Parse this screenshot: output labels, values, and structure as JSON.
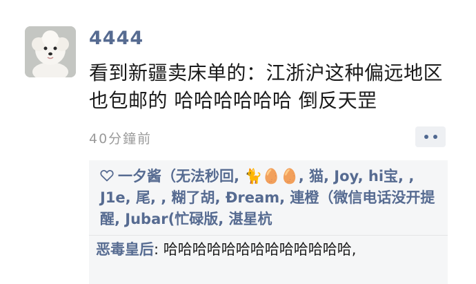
{
  "post": {
    "username": "4444",
    "text": "看到新疆卖床单的：江浙沪这种偏远地区也包邮的 哈哈哈哈哈哈 倒反天罡",
    "timestamp": "40分鐘前",
    "avatar_icon": "bichon-dog-avatar",
    "more_icon": "more-dots-icon"
  },
  "likes": {
    "icon": "heart-outline-icon",
    "names_text": "一夕酱（无法秒回, 🐈🥚🥚, 猫, Joy, hi宝, , J1e, 尾, , 糊了胡, Đream, 連橙（微信电话没开提醒, Jubar(忙碌版, 湛星杭"
  },
  "comments": [
    {
      "author": "恶毒皇后",
      "separator": ": ",
      "text": "哈哈哈哈哈哈哈哈哈哈哈哈哈,"
    }
  ],
  "colors": {
    "name_blue": "#566b91",
    "text": "#1a1a1a",
    "timestamp_gray": "#9a9a9a",
    "box_background": "#f5f6f7"
  }
}
